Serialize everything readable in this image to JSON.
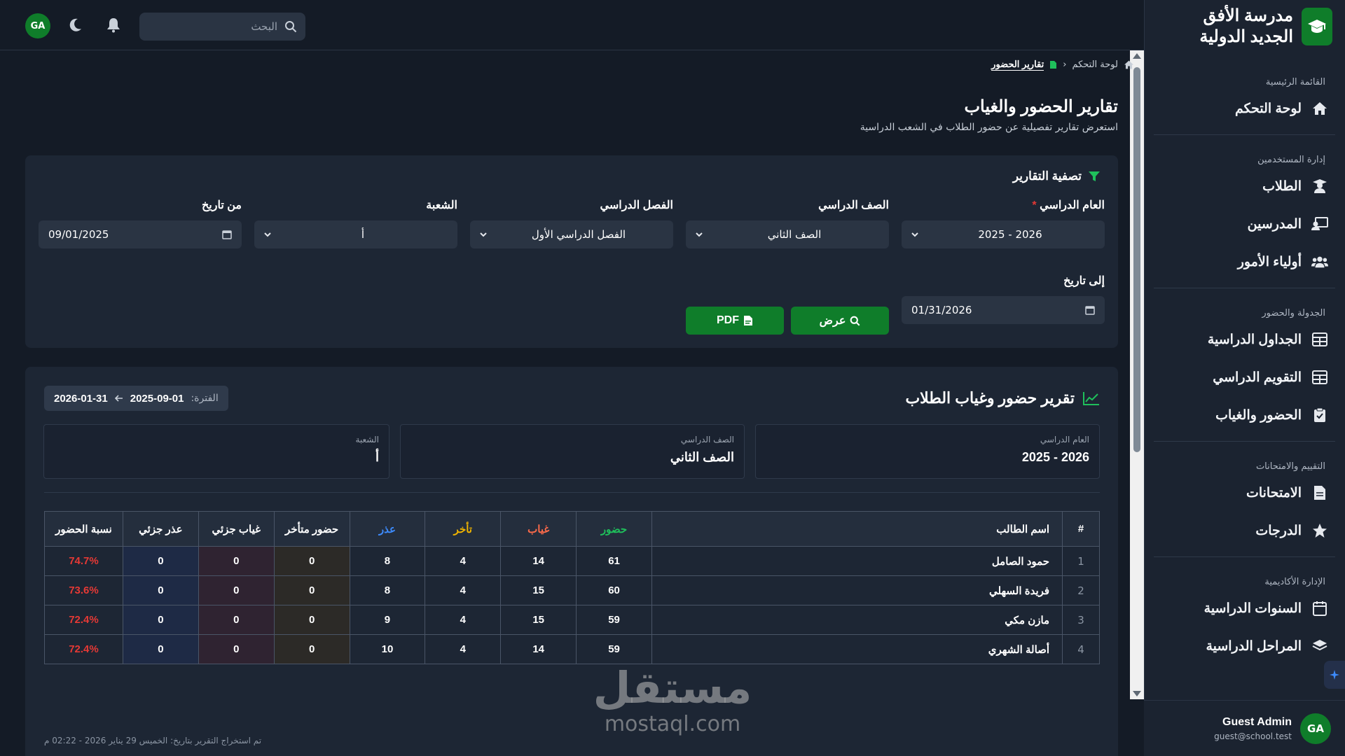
{
  "brand": {
    "name": "مدرسة الأفق الجديد الدولية"
  },
  "topbar": {
    "search_placeholder": "البحث",
    "avatar_initials": "GA"
  },
  "sidebar": {
    "groups": [
      {
        "title": "القائمة الرئيسية",
        "items": [
          {
            "label": "لوحة التحكم",
            "icon": "home-icon"
          }
        ]
      },
      {
        "title": "إدارة المستخدمين",
        "items": [
          {
            "label": "الطلاب",
            "icon": "student-icon"
          },
          {
            "label": "المدرسين",
            "icon": "teacher-icon"
          },
          {
            "label": "أولياء الأمور",
            "icon": "parents-icon"
          }
        ]
      },
      {
        "title": "الجدولة والحضور",
        "items": [
          {
            "label": "الجداول الدراسية",
            "icon": "table-icon"
          },
          {
            "label": "التقويم الدراسي",
            "icon": "calendar-grid-icon"
          },
          {
            "label": "الحضور والغياب",
            "icon": "clipboard-check-icon"
          }
        ]
      },
      {
        "title": "التقييم والامتحانات",
        "items": [
          {
            "label": "الامتحانات",
            "icon": "document-icon"
          },
          {
            "label": "الدرجات",
            "icon": "star-icon"
          }
        ]
      },
      {
        "title": "الإدارة الأكاديمية",
        "items": [
          {
            "label": "السنوات الدراسية",
            "icon": "calendar-icon"
          },
          {
            "label": "المراحل الدراسية",
            "icon": "layers-icon"
          }
        ]
      }
    ],
    "user": {
      "initials": "GA",
      "name": "Guest Admin",
      "email": "guest@school.test"
    }
  },
  "breadcrumb": {
    "home": "لوحة التحكم",
    "current": "تقارير الحضور"
  },
  "page": {
    "title": "تقارير الحضور والغياب",
    "subtitle": "استعرض تقارير تفصيلية عن حضور الطلاب في الشعب الدراسية"
  },
  "filters": {
    "title": "تصفية التقارير",
    "academic_year": {
      "label": "العام الدراسي",
      "required_mark": "*",
      "value": "2025 - 2026"
    },
    "grade": {
      "label": "الصف الدراسي",
      "value": "الصف الثاني"
    },
    "semester": {
      "label": "الفصل الدراسي",
      "value": "الفصل الدراسي الأول"
    },
    "section": {
      "label": "الشعبة",
      "value": "أ"
    },
    "from_date": {
      "label": "من تاريخ",
      "value": "09/01/2025"
    },
    "to_date": {
      "label": "إلى تاريخ",
      "value": "01/31/2026"
    },
    "show_button": "عرض",
    "pdf_button": "PDF"
  },
  "report": {
    "title": "تقرير حضور وغياب الطلاب",
    "period_label": "الفترة:",
    "period_from": "2025-09-01",
    "period_to": "2026-01-31",
    "info": {
      "year": {
        "label": "العام الدراسي",
        "value": "2025 - 2026"
      },
      "grade": {
        "label": "الصف الدراسي",
        "value": "الصف الثاني"
      },
      "section": {
        "label": "الشعبة",
        "value": "أ"
      }
    },
    "columns": [
      "#",
      "اسم الطالب",
      "حضور",
      "غياب",
      "تأخر",
      "عذر",
      "حضور متأخر",
      "غياب جزئي",
      "عذر جزئي",
      "نسبة الحضور"
    ],
    "column_colors": {
      "present": "#1fbf5b",
      "absent": "#ff6b4a",
      "late": "#f0b400",
      "excused": "#3d8bfd"
    },
    "rows": [
      {
        "n": "1",
        "name": "حمود الصامل",
        "present": "61",
        "absent": "14",
        "late": "4",
        "excused": "8",
        "late_present": "0",
        "partial_absent": "0",
        "partial_excused": "0",
        "rate": "74.7%"
      },
      {
        "n": "2",
        "name": "فريدة السهلي",
        "present": "60",
        "absent": "15",
        "late": "4",
        "excused": "8",
        "late_present": "0",
        "partial_absent": "0",
        "partial_excused": "0",
        "rate": "73.6%"
      },
      {
        "n": "3",
        "name": "مازن مكي",
        "present": "59",
        "absent": "15",
        "late": "4",
        "excused": "9",
        "late_present": "0",
        "partial_absent": "0",
        "partial_excused": "0",
        "rate": "72.4%"
      },
      {
        "n": "4",
        "name": "أصالة الشهري",
        "present": "59",
        "absent": "14",
        "late": "4",
        "excused": "10",
        "late_present": "0",
        "partial_absent": "0",
        "partial_excused": "0",
        "rate": "72.4%"
      }
    ],
    "footnote": "تم استخراج التقرير بتاريخ: الخميس 29 يناير 2026 - 02:22 م"
  },
  "watermark": {
    "arabic": "مستقل",
    "latin": "mostaql.com"
  },
  "colors": {
    "accent": "#0f7d2a",
    "danger": "#e53935",
    "background": "#141b26",
    "card": "#1d2634"
  }
}
